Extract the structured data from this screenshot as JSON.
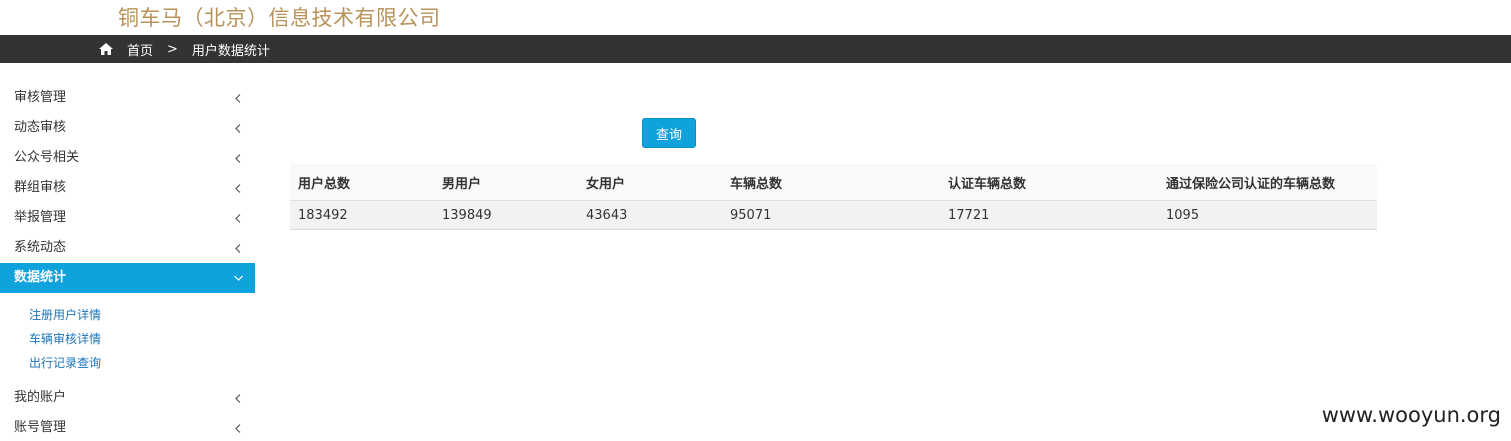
{
  "header": {
    "company_name": "铜车马（北京）信息技术有限公司"
  },
  "breadcrumb": {
    "home_icon": "home-icon",
    "home_label": "首页",
    "separator": ">",
    "current": "用户数据统计"
  },
  "sidebar": {
    "items_top": [
      {
        "label": "审核管理"
      },
      {
        "label": "动态审核"
      },
      {
        "label": "公众号相关"
      },
      {
        "label": "群组审核"
      },
      {
        "label": "举报管理"
      },
      {
        "label": "系统动态"
      }
    ],
    "active": {
      "label": "数据统计"
    },
    "subitems": [
      {
        "label": "注册用户详情"
      },
      {
        "label": "车辆审核详情"
      },
      {
        "label": "出行记录查询"
      }
    ],
    "items_bottom": [
      {
        "label": "我的账户"
      },
      {
        "label": "账号管理"
      }
    ],
    "active_color": "#0fa2dd"
  },
  "main": {
    "query_label": "查询",
    "table": {
      "headers": [
        "用户总数",
        "男用户",
        "女用户",
        "车辆总数",
        "认证车辆总数",
        "通过保险公司认证的车辆总数"
      ],
      "rows": [
        [
          "183492",
          "139849",
          "43643",
          "95071",
          "17721",
          "1095"
        ]
      ]
    }
  },
  "watermark": "www.wooyun.org"
}
